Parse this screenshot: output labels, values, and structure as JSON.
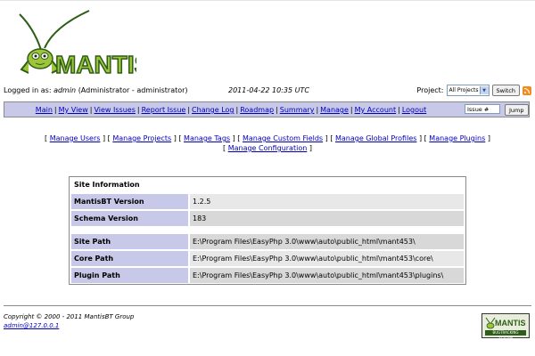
{
  "logo": {
    "text": "MANTIS"
  },
  "login": {
    "prefix": "Logged in as:",
    "username": "admin",
    "role": "(Administrator - administrator)",
    "timestamp": "2011-04-22 10:35 UTC",
    "project_label": "Project:",
    "project_selected": "All Projects",
    "switch_label": "Switch"
  },
  "main_menu": {
    "items": [
      "Main",
      "My View",
      "View Issues",
      "Report Issue",
      "Change Log",
      "Roadmap",
      "Summary",
      "Manage",
      "My Account",
      "Logout"
    ],
    "issue_placeholder": "Issue #",
    "jump_label": "Jump"
  },
  "manage_menu": {
    "items": [
      "Manage Users",
      "Manage Projects",
      "Manage Tags",
      "Manage Custom Fields",
      "Manage Global Profiles",
      "Manage Plugins",
      "Manage Configuration"
    ]
  },
  "site_info": {
    "title": "Site Information",
    "version_label": "MantisBT Version",
    "version_value": "1.2.5",
    "schema_label": "Schema Version",
    "schema_value": "183",
    "site_path_label": "Site Path",
    "site_path_value": "E:\\Program Files\\EasyPhp 3.0\\www\\auto\\public_html\\mant453\\",
    "core_path_label": "Core Path",
    "core_path_value": "E:\\Program Files\\EasyPhp 3.0\\www\\auto\\public_html\\mant453\\core\\",
    "plugin_path_label": "Plugin Path",
    "plugin_path_value": "E:\\Program Files\\EasyPhp 3.0\\www\\auto\\public_html\\mant453\\plugins\\"
  },
  "footer": {
    "copyright": "Copyright © 2000 - 2011 MantisBT Group",
    "email": "admin@127.0.0.1",
    "badge_text": "MANTIS",
    "badge_sub": "BUGTRACKING SYSTEM"
  },
  "colors": {
    "menu_bg": "#c8c8e8",
    "link": "#0000bb",
    "logo_green": "#2d5d18"
  }
}
